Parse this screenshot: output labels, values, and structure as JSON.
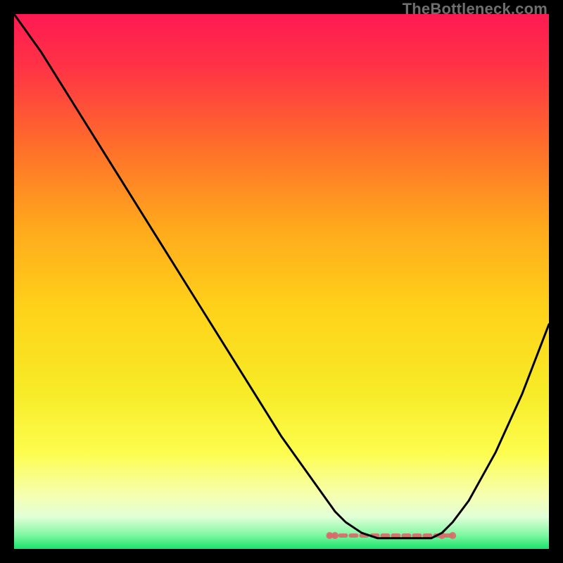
{
  "watermark": "TheBottleneck.com",
  "chart_data": {
    "type": "line",
    "title": "",
    "xlabel": "",
    "ylabel": "",
    "xlim": [
      0,
      100
    ],
    "ylim": [
      0,
      100
    ],
    "grid": false,
    "series": [
      {
        "name": "curve",
        "x": [
          0,
          5,
          10,
          15,
          20,
          25,
          30,
          35,
          40,
          45,
          50,
          55,
          60,
          62,
          65,
          68,
          70,
          72,
          75,
          78,
          80,
          82,
          85,
          90,
          95,
          100
        ],
        "y": [
          100,
          93,
          85,
          77,
          69,
          61,
          53,
          45,
          37,
          29,
          21,
          14,
          7,
          5,
          3,
          2,
          2,
          2,
          2,
          2,
          3,
          5,
          9,
          18,
          29,
          42
        ]
      }
    ],
    "highlight_band": {
      "x_start": 59,
      "x_end": 82,
      "y": 2.5
    },
    "highlight_markers_x": [
      59,
      60,
      80,
      82
    ],
    "gradient_stops": [
      {
        "offset": 0.0,
        "color": "#ff1a52"
      },
      {
        "offset": 0.1,
        "color": "#ff3345"
      },
      {
        "offset": 0.25,
        "color": "#ff6f2a"
      },
      {
        "offset": 0.4,
        "color": "#ffa91c"
      },
      {
        "offset": 0.55,
        "color": "#ffd21a"
      },
      {
        "offset": 0.7,
        "color": "#f7ea26"
      },
      {
        "offset": 0.82,
        "color": "#fdfd4d"
      },
      {
        "offset": 0.9,
        "color": "#f6ffb0"
      },
      {
        "offset": 0.94,
        "color": "#e2ffd8"
      },
      {
        "offset": 0.975,
        "color": "#7cf7a0"
      },
      {
        "offset": 1.0,
        "color": "#19e46a"
      }
    ]
  }
}
